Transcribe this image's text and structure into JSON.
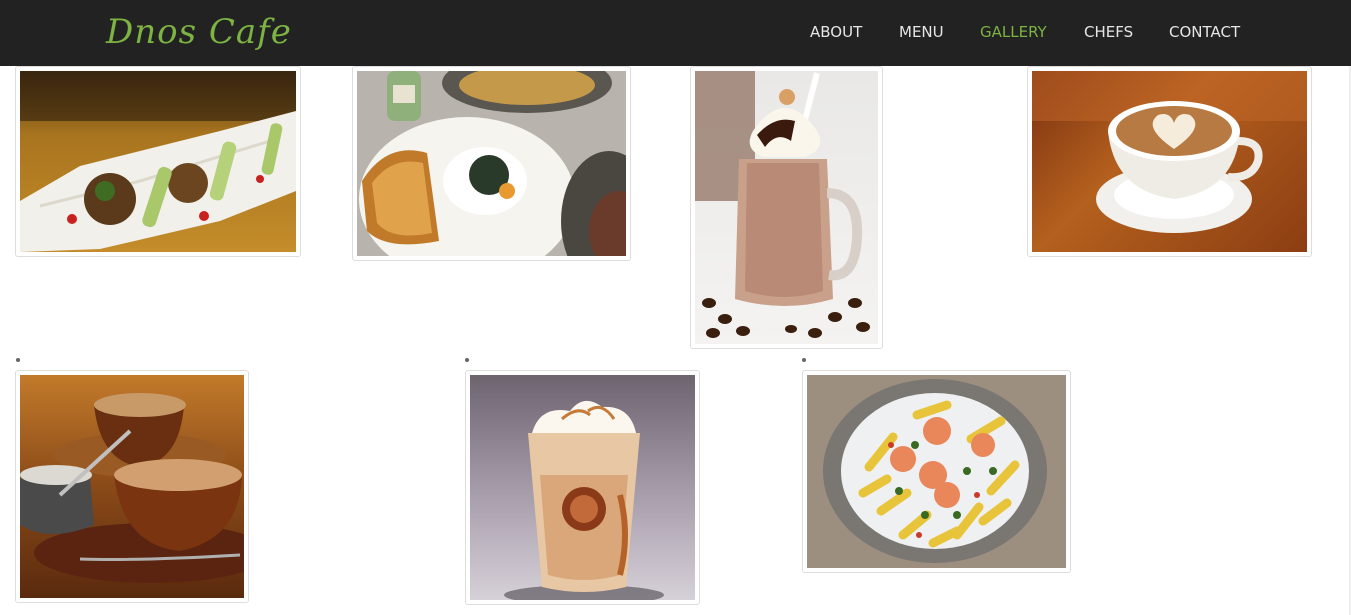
{
  "brand": {
    "name": "Dnos Cafe"
  },
  "nav": {
    "items": [
      {
        "label": "ABOUT",
        "active": false
      },
      {
        "label": "MENU",
        "active": false
      },
      {
        "label": "GALLERY",
        "active": true
      },
      {
        "label": "CHEFS",
        "active": false
      },
      {
        "label": "CONTACT",
        "active": false
      }
    ]
  },
  "colors": {
    "navbar_bg": "#222222",
    "accent": "#7cb342",
    "nav_text": "#e6e6e6",
    "page_bg": "#ffffff"
  },
  "gallery": {
    "photos": [
      {
        "subject": "appetizer-platter-photo"
      },
      {
        "subject": "toast-and-egg-plate-photo"
      },
      {
        "subject": "chocolate-milkshake-jar-photo"
      },
      {
        "subject": "latte-art-cup-photo"
      },
      {
        "subject": "cappuccino-cups-photo"
      },
      {
        "subject": "iced-frappe-cup-photo"
      },
      {
        "subject": "shrimp-penne-pasta-photo"
      }
    ]
  }
}
